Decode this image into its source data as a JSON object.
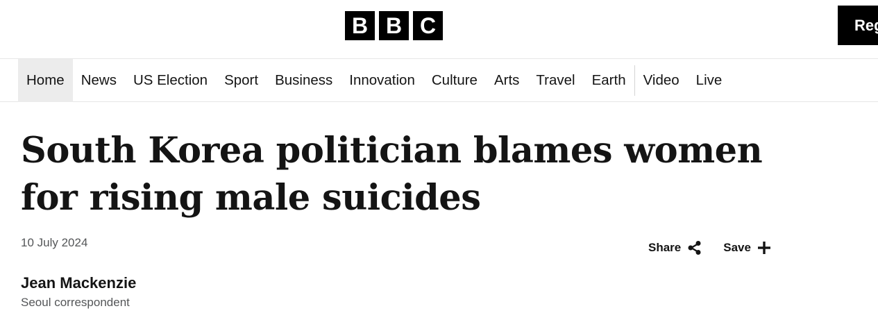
{
  "header": {
    "logo_letters": [
      "B",
      "B",
      "C"
    ],
    "register_label": "Reg"
  },
  "nav": {
    "items": [
      {
        "label": "Home",
        "active": true
      },
      {
        "label": "News"
      },
      {
        "label": "US Election"
      },
      {
        "label": "Sport"
      },
      {
        "label": "Business"
      },
      {
        "label": "Innovation"
      },
      {
        "label": "Culture"
      },
      {
        "label": "Arts"
      },
      {
        "label": "Travel"
      },
      {
        "label": "Earth"
      },
      {
        "label": "Video"
      },
      {
        "label": "Live"
      }
    ]
  },
  "article": {
    "headline": "South Korea politician blames women for rising male suicides",
    "date": "10 July 2024",
    "share_label": "Share",
    "save_label": "Save",
    "author": {
      "name": "Jean Mackenzie",
      "role": "Seoul correspondent"
    }
  },
  "icons": {
    "share": "share-icon",
    "save": "plus-icon"
  },
  "colors": {
    "brand_black": "#000000",
    "text": "#141414",
    "muted": "#545658",
    "nav_active_bg": "#ececec"
  }
}
